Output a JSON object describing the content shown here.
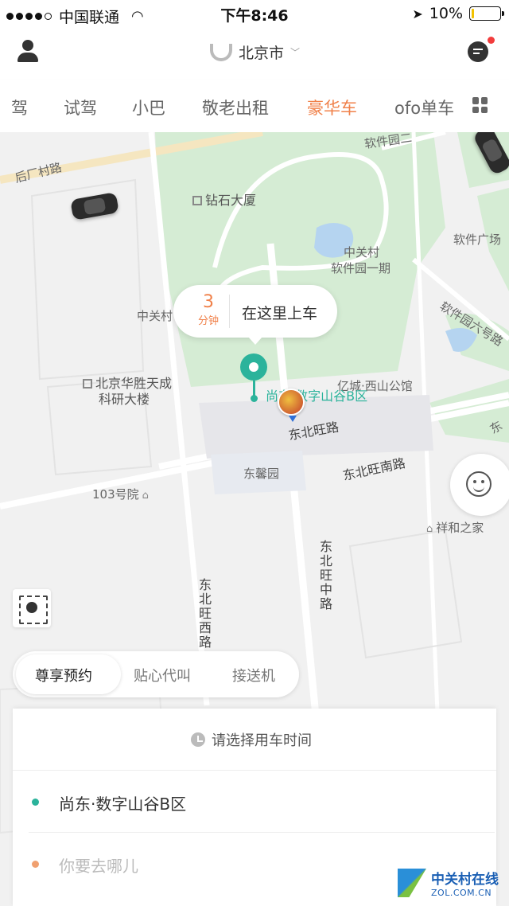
{
  "status_bar": {
    "carrier": "中国联通",
    "time": "下午8:46",
    "battery": "10%"
  },
  "header": {
    "city": "北京市"
  },
  "tabs": [
    "驾",
    "试驾",
    "小巴",
    "敬老出租",
    "豪华车",
    "ofo单车"
  ],
  "active_tab": "豪华车",
  "map": {
    "labels": {
      "houchang_road": "后厂村路",
      "software_park_2": "软件园二",
      "diamond_tower": "钻石大厦",
      "zgc": "中关村",
      "software_park_1": "软件园一期",
      "software_plaza": "软件广场",
      "software_park_6": "软件园六号路",
      "zgc_west": "中关村",
      "hs_line1": "北京华胜天成",
      "hs_line2": "科研大楼",
      "yicheng": "亿城·西山公馆",
      "place_pin": "尚东·数字山谷B区",
      "dbw_road": "东北旺路",
      "dxy": "东馨园",
      "dbwn_road": "东北旺南路",
      "c103": "103号院",
      "xhzj": "祥和之家",
      "dbwx_road": "东北旺西路",
      "dbwz_road": "东北旺中路",
      "east_edge": "东"
    }
  },
  "pickup": {
    "eta_value": "3",
    "eta_unit": "分钟",
    "action": "在这里上车"
  },
  "service_options": [
    "尊享预约",
    "贴心代叫",
    "接送机"
  ],
  "active_service": "尊享预约",
  "booking": {
    "time_prompt": "请选择用车时间",
    "from": "尚东·数字山谷B区",
    "to_placeholder": "你要去哪儿"
  },
  "colors": {
    "accent_orange": "#f0814a",
    "pin_teal": "#2bb39b",
    "park_green": "#d5ecd4"
  },
  "watermark": {
    "title": "中关村在线",
    "subtitle": "ZOL.COM.CN"
  }
}
